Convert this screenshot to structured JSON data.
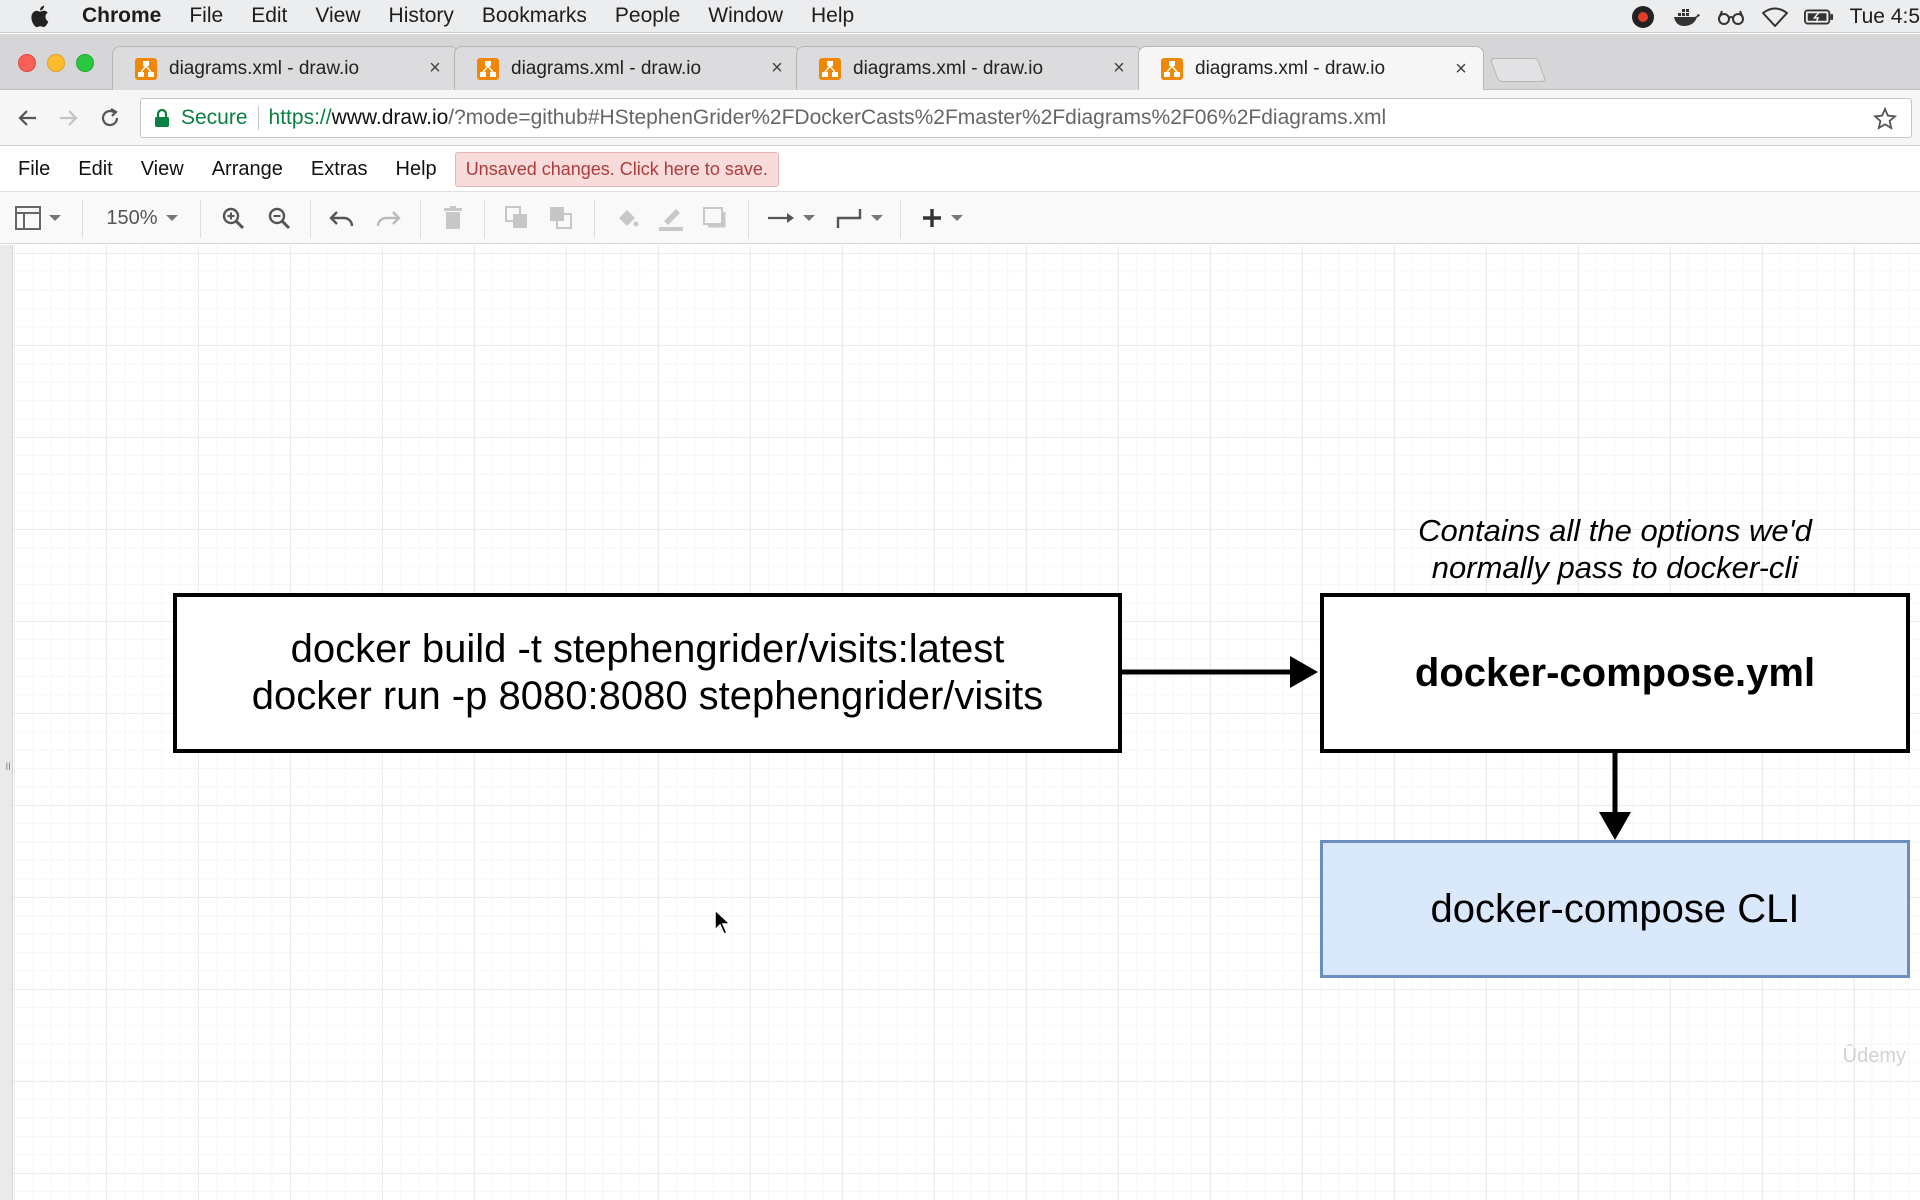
{
  "macos_menubar": {
    "app_name": "Chrome",
    "items": [
      "File",
      "Edit",
      "View",
      "History",
      "Bookmarks",
      "People",
      "Window",
      "Help"
    ],
    "status_icons": [
      "creative-cloud-icon",
      "docker-icon",
      "glasses-icon",
      "wifi-icon",
      "battery-icon"
    ],
    "clock": "Tue 4:5"
  },
  "browser": {
    "tabs": [
      {
        "title": "diagrams.xml - draw.io",
        "active": false
      },
      {
        "title": "diagrams.xml - draw.io",
        "active": false
      },
      {
        "title": "diagrams.xml - draw.io",
        "active": false
      },
      {
        "title": "diagrams.xml - draw.io",
        "active": true
      }
    ],
    "close_glyph": "×",
    "address": {
      "secure_label": "Secure",
      "scheme": "https://",
      "host": "www.draw.io",
      "path": "/?mode=github#HStephenGrider%2FDockerCasts%2Fmaster%2Fdiagrams%2F06%2Fdiagrams.xml"
    }
  },
  "drawio": {
    "menu": [
      "File",
      "Edit",
      "View",
      "Arrange",
      "Extras",
      "Help"
    ],
    "unsaved_notice": "Unsaved changes. Click here to save.",
    "toolbar": {
      "zoom": "150%",
      "buttons": [
        "format-panel-icon",
        "zoom-in-icon",
        "zoom-out-icon",
        "undo-icon",
        "redo-icon",
        "delete-icon",
        "to-front-icon",
        "to-back-icon",
        "fill-color-icon",
        "line-color-icon",
        "shadow-icon",
        "connection-icon",
        "waypoints-icon",
        "insert-icon"
      ]
    }
  },
  "diagram": {
    "commands_box": {
      "line1": "docker build -t stephengrider/visits:latest",
      "line2": "docker run -p 8080:8080 stephengrider/visits"
    },
    "compose_yml_box": "docker-compose.yml",
    "annotation": {
      "line1": "Contains all the options we'd",
      "line2": "normally pass to docker-cli"
    },
    "compose_cli_box": "docker-compose CLI",
    "colors": {
      "cli_fill": "#dae8fc",
      "cli_stroke": "#6c8ebf"
    }
  },
  "watermark": "Ûdemy"
}
